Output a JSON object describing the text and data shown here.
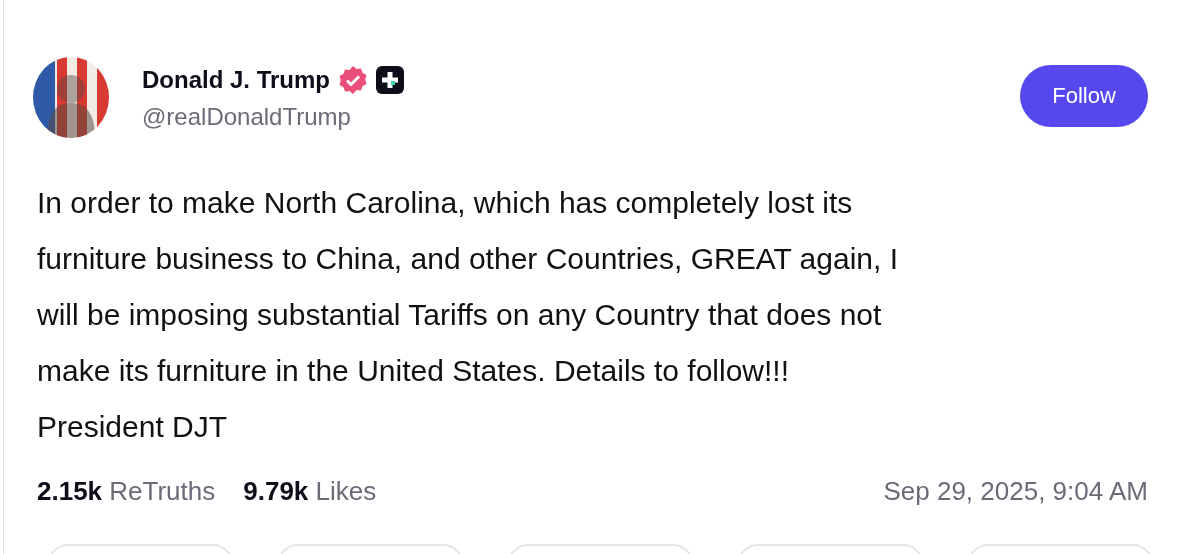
{
  "author": {
    "name": "Donald J. Trump",
    "handle": "@realDonaldTrump",
    "verified": true
  },
  "follow_button": {
    "label": "Follow"
  },
  "body": "In order to make North Carolina, which has completely lost its\nfurniture business to China, and other Countries, GREAT again, I\nwill be imposing substantial Tariffs on any Country that does not\nmake its furniture in the United States. Details to follow!!!\nPresident DJT",
  "stats": [
    {
      "count": "2.15k",
      "label": "ReTruths"
    },
    {
      "count": "9.79k",
      "label": "Likes"
    }
  ],
  "timestamp": "Sep 29, 2025, 9:04 AM"
}
